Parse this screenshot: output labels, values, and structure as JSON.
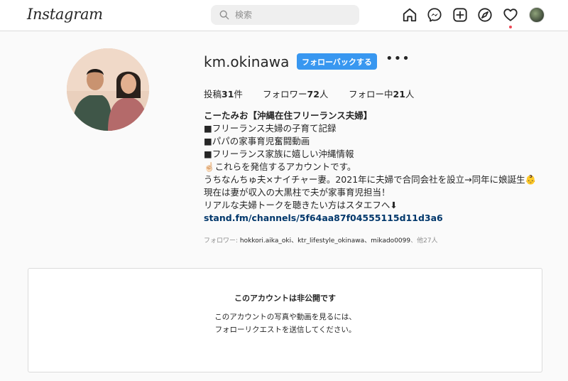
{
  "header": {
    "logo": "Instagram",
    "search_placeholder": "検索",
    "nav": [
      "home-icon",
      "messenger-icon",
      "new-post-icon",
      "explore-icon",
      "activity-heart-icon",
      "profile-avatar"
    ]
  },
  "profile": {
    "username": "km.okinawa",
    "follow_back_label": "フォローバックする",
    "more_label": "•••",
    "stats": {
      "posts_label": "投稿",
      "posts_count": "31",
      "posts_unit": "件",
      "followers_label": "フォロワー",
      "followers_count": "72",
      "followers_unit": "人",
      "following_label": "フォロー中",
      "following_count": "21",
      "following_unit": "人"
    },
    "bio": {
      "name": "こーたみお【沖縄在住フリーランス夫婦】",
      "lines": [
        "■フリーランス夫婦の子育て記録",
        "■パパの家事育児奮闘動画",
        "■フリーランス家族に嬉しい沖縄情報",
        "☝🏻これらを発信するアカウントです。",
        "うちなんちゅ夫×ナイチャー妻。2021年に夫婦で合同会社を設立→同年に娘誕生👶現在は妻が収入の大黒柱で夫が家事育児担当！",
        "リアルな夫婦トークを聴きたい方はスタエフへ⬇"
      ],
      "link": "stand.fm/channels/5f64aa87f04555115d11d3a6"
    },
    "followed_by": {
      "prefix": "フォロワー: ",
      "accounts": "hokkori.aika_oki、ktr_lifestyle_okinawa、mikado0099",
      "suffix": "、他27人"
    }
  },
  "private": {
    "title": "このアカウントは非公開です",
    "description": "このアカウントの写真や動画を見るには、フォローリクエストを送信してください。"
  },
  "colors": {
    "accent": "#3897f0",
    "link": "#00376b",
    "border": "#dbdbdb",
    "muted": "#8e8e8e",
    "notification": "#ed4956"
  }
}
